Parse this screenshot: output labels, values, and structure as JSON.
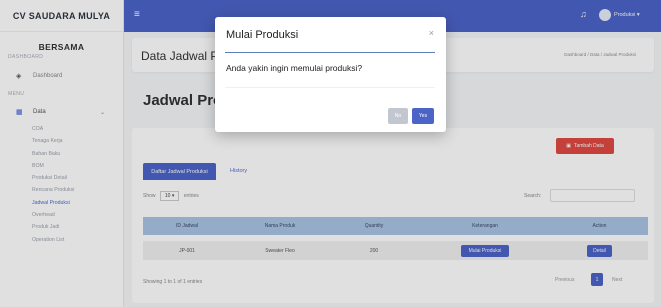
{
  "sidebar": {
    "brand": "CV SAUDARA MULYA",
    "sub_brand": "BERSAMA",
    "section_dashboard": "DASHBOARD",
    "dashboard": "Dashboard",
    "section_menu": "MENU",
    "data_label": "Data",
    "items": [
      "COA",
      "Tenaga Kerja",
      "Bahan Baku",
      "BOM",
      "Produksi Detail",
      "Rencana Produksi",
      "Jadwal Produksi",
      "Overhead",
      "Produk Jadi",
      "Operation List"
    ]
  },
  "topbar": {
    "user": "Produksi ▾"
  },
  "header": {
    "title": "Data Jadwal Produksi",
    "breadcrumb": "Dashboard / Data / Jadwal Produksi"
  },
  "page_title": "Jadwal Produksi",
  "card": {
    "add_button": "Tambah Data",
    "tab_active": "Daftar Jadwal Produksi",
    "tab_history": "History",
    "show_label": "Show",
    "show_value": "10 ▾",
    "entries_label": "entries",
    "search_label": "Search:",
    "columns": [
      "ID Jadwal",
      "Nama Produk",
      "Quantity",
      "Keterangan",
      "Action"
    ],
    "row": {
      "id": "JP-001",
      "produk": "Sweater Fleo",
      "qty": "200",
      "keterangan": "Mulai Produksi",
      "action": "Detail"
    },
    "info": "Showing 1 to 1 of 1 entries",
    "prev": "Previous",
    "page": "1",
    "next": "Next"
  },
  "modal": {
    "title": "Mulai Produksi",
    "close": "×",
    "body": "Anda yakin ingin memulai produksi?",
    "no": "No",
    "yes": "Yes"
  }
}
